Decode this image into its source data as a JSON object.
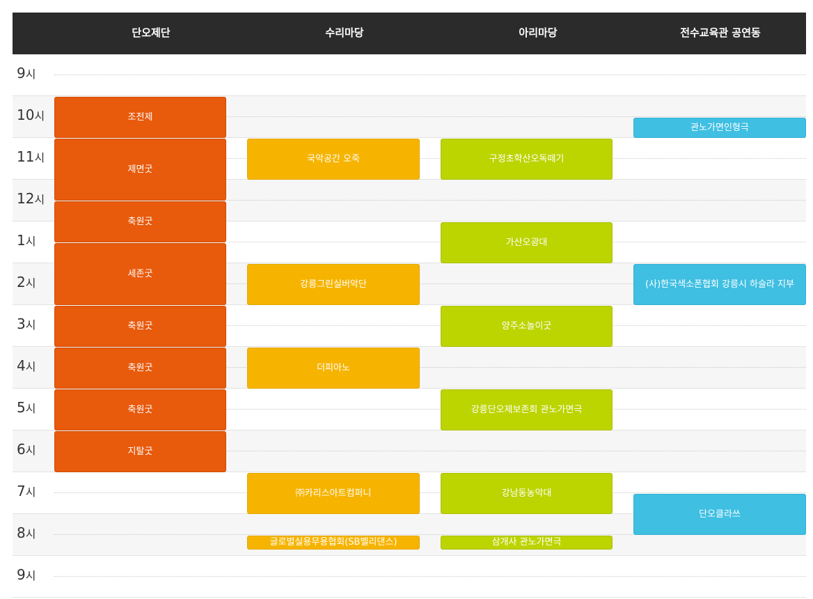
{
  "venues": [
    "단오제단",
    "수리마당",
    "아리마당",
    "전수교육관 공연동"
  ],
  "hours": [
    {
      "num": "9",
      "unit": "시"
    },
    {
      "num": "10",
      "unit": "시"
    },
    {
      "num": "11",
      "unit": "시"
    },
    {
      "num": "12",
      "unit": "시"
    },
    {
      "num": "1",
      "unit": "시"
    },
    {
      "num": "2",
      "unit": "시"
    },
    {
      "num": "3",
      "unit": "시"
    },
    {
      "num": "4",
      "unit": "시"
    },
    {
      "num": "5",
      "unit": "시"
    },
    {
      "num": "6",
      "unit": "시"
    },
    {
      "num": "7",
      "unit": "시"
    },
    {
      "num": "8",
      "unit": "시"
    },
    {
      "num": "9",
      "unit": "시"
    }
  ],
  "colors": {
    "단오제단": "#e85a0c",
    "수리마당": "#f6b400",
    "아리마당": "#bcd400",
    "전수교육관 공연동": "#3fbfe2",
    "header": "#2b2b2b"
  },
  "events": [
    {
      "venue": 0,
      "title": "조전제",
      "start": "10:00",
      "end": "11:00"
    },
    {
      "venue": 0,
      "title": "제면굿",
      "start": "11:00",
      "end": "12:30"
    },
    {
      "venue": 0,
      "title": "축원굿",
      "start": "12:30",
      "end": "1:30"
    },
    {
      "venue": 0,
      "title": "세존굿",
      "start": "1:30",
      "end": "3:00"
    },
    {
      "venue": 0,
      "title": "축원굿",
      "start": "3:00",
      "end": "4:00"
    },
    {
      "venue": 0,
      "title": "축원굿",
      "start": "4:00",
      "end": "5:00"
    },
    {
      "venue": 0,
      "title": "축원굿",
      "start": "5:00",
      "end": "6:00"
    },
    {
      "venue": 0,
      "title": "지탈굿",
      "start": "6:00",
      "end": "7:00"
    },
    {
      "venue": 1,
      "title": "국악공간 오죽",
      "start": "11:00",
      "end": "12:00"
    },
    {
      "venue": 1,
      "title": "강릉그린실버악단",
      "start": "2:00",
      "end": "3:00"
    },
    {
      "venue": 1,
      "title": "더피아노",
      "start": "4:00",
      "end": "5:00"
    },
    {
      "venue": 1,
      "title": "㈜카리스아트컴퍼니",
      "start": "7:00",
      "end": "8:00"
    },
    {
      "venue": 1,
      "title": "글로벌실용무용협회(SB벨리댄스)",
      "start": "8:30",
      "end": "9:30"
    },
    {
      "venue": 2,
      "title": "구정초학산오독떼기",
      "start": "11:00",
      "end": "12:00"
    },
    {
      "venue": 2,
      "title": "가산오광대",
      "start": "1:00",
      "end": "2:00"
    },
    {
      "venue": 2,
      "title": "양주소놀이굿",
      "start": "3:00",
      "end": "4:00"
    },
    {
      "venue": 2,
      "title": "강릉단오제보존회 관노가면극",
      "start": "5:00",
      "end": "6:00"
    },
    {
      "venue": 2,
      "title": "강남동농악대",
      "start": "7:00",
      "end": "8:00"
    },
    {
      "venue": 2,
      "title": "삼개사 관노가면극",
      "start": "8:30",
      "end": "9:30"
    },
    {
      "venue": 3,
      "title": "관노가면인형극",
      "start": "10:30",
      "end": "11:00"
    },
    {
      "venue": 3,
      "title": "(사)한국색소폰협회 강릉시 하슬라 지부",
      "start": "2:00",
      "end": "3:00"
    },
    {
      "venue": 3,
      "title": "단오클라쓰",
      "start": "7:30",
      "end": "8:30"
    }
  ]
}
